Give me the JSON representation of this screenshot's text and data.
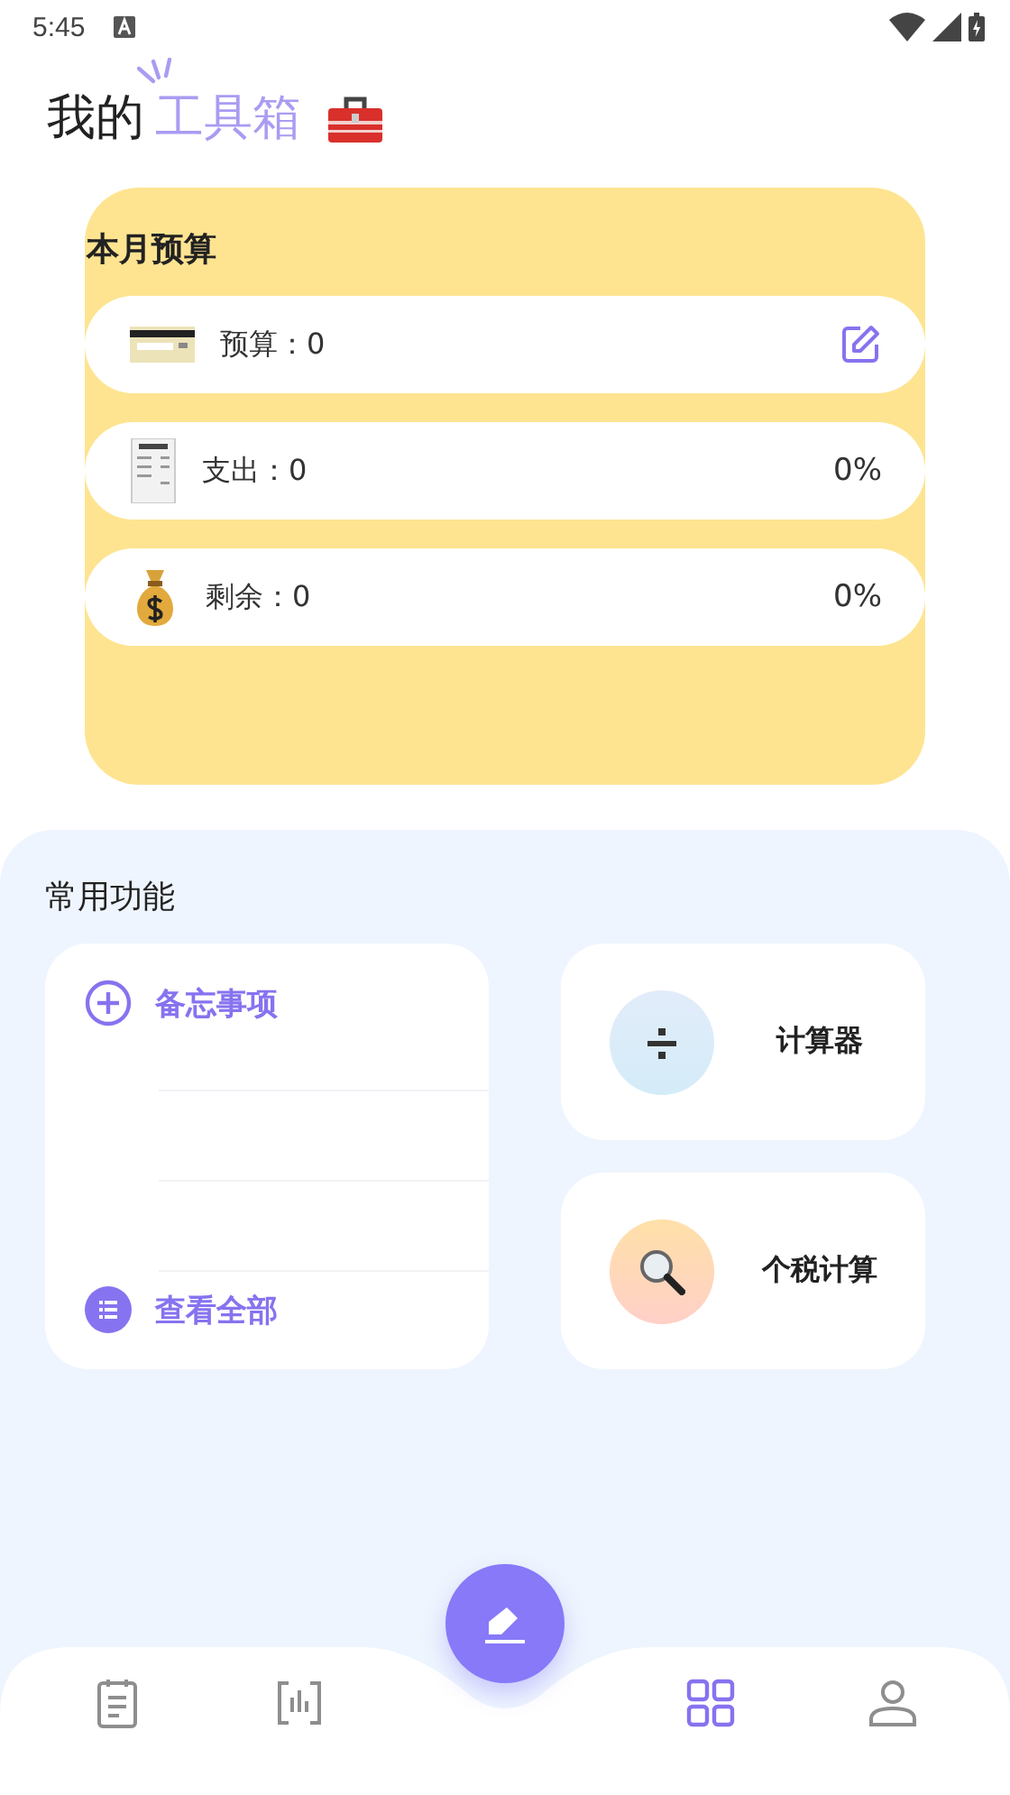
{
  "status_bar": {
    "time": "5:45"
  },
  "header": {
    "title_plain": "我的",
    "title_accent": "工具箱"
  },
  "budget": {
    "title": "本月预算",
    "rows": [
      {
        "kind": "edit",
        "label": "预算：0"
      },
      {
        "kind": "percent",
        "label": "支出：0",
        "percent": "0%"
      },
      {
        "kind": "percent",
        "label": "剩余：0",
        "percent": "0%"
      }
    ]
  },
  "functions": {
    "title": "常用功能",
    "memo": {
      "add": "备忘事项",
      "view_all": "查看全部"
    },
    "tools": [
      {
        "label": "计算器"
      },
      {
        "label": "个税计算"
      }
    ]
  },
  "nav": [
    {
      "selected": false
    },
    {
      "selected": false
    },
    {
      "selected": true
    },
    {
      "selected": false
    }
  ]
}
